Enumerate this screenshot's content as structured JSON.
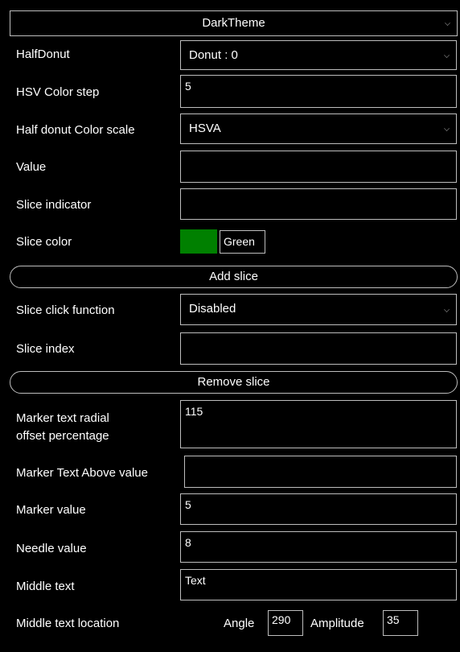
{
  "theme_select": {
    "value": "DarkTheme"
  },
  "half_donut": {
    "label": "HalfDonut",
    "value": "Donut : 0"
  },
  "hsv_step": {
    "label": "HSV Color step",
    "value": "5"
  },
  "color_scale": {
    "label": "Half donut Color scale",
    "value": "HSVA"
  },
  "value_field": {
    "label": "Value",
    "value": ""
  },
  "slice_indicator": {
    "label": "Slice indicator",
    "value": ""
  },
  "slice_color": {
    "label": "Slice color",
    "color": "#008000",
    "name": "Green"
  },
  "add_slice": {
    "label": "Add slice"
  },
  "slice_click": {
    "label": "Slice click function",
    "value": "Disabled"
  },
  "slice_index": {
    "label": "Slice index",
    "value": ""
  },
  "remove_slice": {
    "label": "Remove slice"
  },
  "marker_radial": {
    "label_line1": "Marker text radial",
    "label_line2": "offset percentage",
    "value": "115"
  },
  "marker_above": {
    "label": "Marker Text Above value",
    "value": ""
  },
  "marker_value": {
    "label": "Marker value",
    "value": "5"
  },
  "needle_value": {
    "label": "Needle value",
    "value": "8"
  },
  "middle_text": {
    "label": "Middle text",
    "value": "Text"
  },
  "middle_location": {
    "label": "Middle text location",
    "angle_label": "Angle",
    "angle_value": "290",
    "amplitude_label": "Amplitude",
    "amplitude_value": "35"
  }
}
